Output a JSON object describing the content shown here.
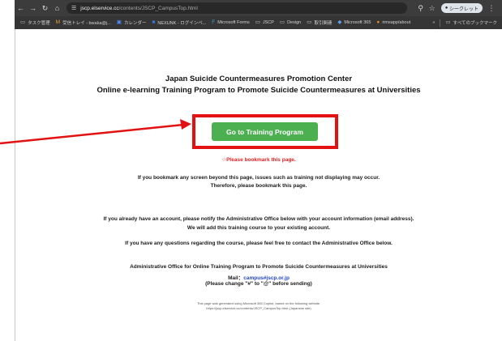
{
  "browser": {
    "url_host": "jscp.elservice.cc",
    "url_path": "/contents/JSCP_CampusTop.html",
    "profile_label": "シークレット",
    "bookmarks": [
      {
        "label": "タスク管理",
        "icon": "folder-icon"
      },
      {
        "label": "受信トレイ - bwaka@j...",
        "icon": "mail-icon"
      },
      {
        "label": "カレンダー",
        "icon": "calendar-icon"
      },
      {
        "label": "NEXUNK - ログインペ...",
        "icon": "site-icon"
      },
      {
        "label": "Microsoft Forms",
        "icon": "forms-icon"
      },
      {
        "label": "JSCP",
        "icon": "folder-icon"
      },
      {
        "label": "Design",
        "icon": "folder-icon"
      },
      {
        "label": "取引関連",
        "icon": "folder-icon"
      },
      {
        "label": "Microsoft 365",
        "icon": "m365-icon"
      },
      {
        "label": "rimsapp/about",
        "icon": "dot-icon"
      }
    ],
    "all_bookmarks_label": "すべてのブックマーク"
  },
  "page": {
    "title_line1": "Japan Suicide Countermeasures Promotion Center",
    "title_line2": "Online e-learning Training Program to Promote Suicide Countermeasures at Universities",
    "go_button_label": "Go to Training Program",
    "bookmark_notice": "☆Please bookmark this page.",
    "bookmark_info_line1": "If you bookmark any screen beyond this page, issues such as training not displaying may occur.",
    "bookmark_info_line2": "Therefore, please bookmark this page.",
    "account_line1": "If you already have an account, please notify the Administrative Office below with your account information (email address).",
    "account_line2": "We will add this training course to your existing account.",
    "questions_line": "If you have any questions regarding the course, please feel free to contact the Administrative Office below.",
    "office_name": "Administrative Office for Online Training Program to Promote Suicide Countermeasures at Universities",
    "mail_label": "Mail：",
    "mail_address": "campus#jscp.or.jp",
    "mail_note": "(Please change \"#\" to \"@\" before sending)",
    "footnote_line1": "This page was generated using Microsoft 365 Copilot, based on the following website.",
    "footnote_line2": "https://jscp.elservice.cc/contents/JSCP_CampusTop.html (Japanese site)"
  },
  "colors": {
    "button_green": "#4caf50",
    "callout_red": "#e21212",
    "notice_red": "#e22222",
    "mail_blue": "#2346c8"
  }
}
